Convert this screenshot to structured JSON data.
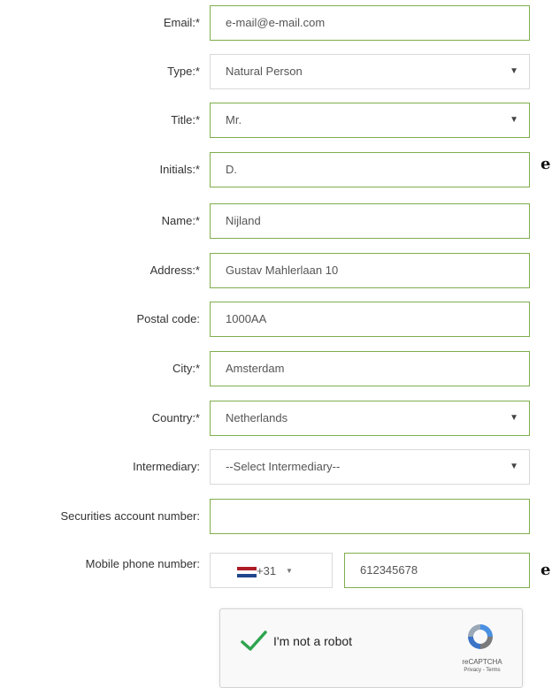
{
  "form": {
    "email": {
      "label": "Email:*",
      "value": "e-mail@e-mail.com"
    },
    "type": {
      "label": "Type:*",
      "value": "Natural Person"
    },
    "title": {
      "label": "Title:*",
      "value": "Mr."
    },
    "initials": {
      "label": "Initials:*",
      "value": "D."
    },
    "name": {
      "label": "Name:*",
      "value": "Nijland"
    },
    "address": {
      "label": "Address:*",
      "value": "Gustav Mahlerlaan 10"
    },
    "postal_code": {
      "label": "Postal code:",
      "value": "1000AA"
    },
    "city": {
      "label": "City:*",
      "value": "Amsterdam"
    },
    "country": {
      "label": "Country:*",
      "value": "Netherlands"
    },
    "intermediary": {
      "label": "Intermediary:",
      "value": "--Select Intermediary--"
    },
    "securities": {
      "label": "Securities account number:",
      "value": ""
    },
    "mobile": {
      "label": "Mobile phone number:",
      "country_code": "+31",
      "value": "612345678"
    }
  },
  "captcha": {
    "label": "I'm not a robot",
    "brand": "reCAPTCHA",
    "links": "Privacy - Terms"
  },
  "icons": {
    "select_caret": "▼",
    "info": "info-icon",
    "check": "check-icon"
  },
  "colors": {
    "valid_border": "#7fae4c",
    "default_border": "#d9d9d9",
    "check_green": "#2ea44f",
    "flag_red": "#ae1c28",
    "flag_white": "#ffffff",
    "flag_blue": "#21468b"
  }
}
